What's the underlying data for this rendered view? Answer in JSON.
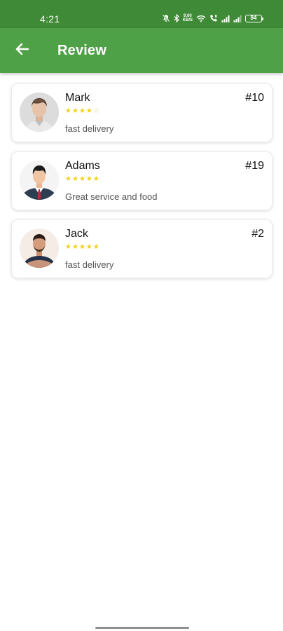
{
  "status_bar": {
    "time": "4:21",
    "speed": "9.00",
    "speed_unit": "KB/S",
    "battery": "84"
  },
  "app_bar": {
    "title": "Review",
    "back_icon": "arrow-left-icon"
  },
  "colors": {
    "status_bar": "#3f8a36",
    "app_bar": "#4ea147",
    "star": "#f2d21b"
  },
  "reviews": [
    {
      "name": "Mark",
      "order": "#10",
      "rating": 4,
      "max_rating": 5,
      "text": "fast delivery"
    },
    {
      "name": "Adams",
      "order": "#19",
      "rating": 5,
      "max_rating": 5,
      "text": "Great service and food"
    },
    {
      "name": "Jack",
      "order": "#2",
      "rating": 5,
      "max_rating": 5,
      "text": "fast delivery"
    }
  ]
}
